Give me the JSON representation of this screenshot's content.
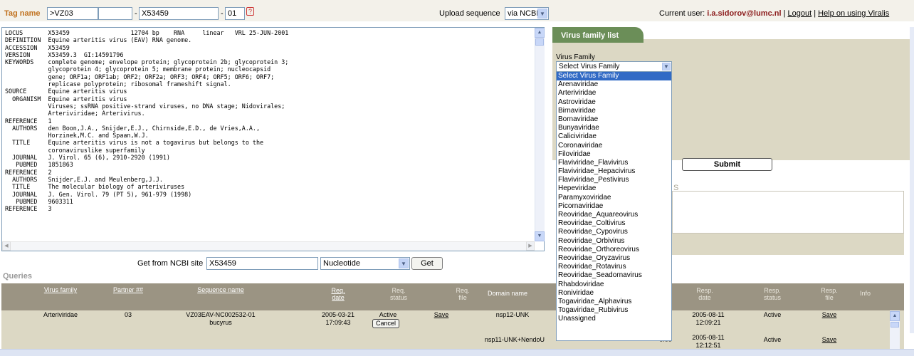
{
  "header": {
    "tag_name_label": "Tag name",
    "tag_field_1": ">VZ03",
    "tag_field_2": "",
    "tag_separator": "-",
    "tag_field_3": "X53459",
    "tag_separator_2": "-",
    "tag_field_4": "01",
    "help_glyph": "?",
    "upload_label": "Upload sequence",
    "upload_option": "via NCBI",
    "current_user_label": "Current user:",
    "current_user": "i.a.sidorov@lumc.nl",
    "separator": "|",
    "logout": "Logout",
    "help_link": "Help on using Viralis"
  },
  "genbank": {
    "text": "LOCUS       X53459                 12704 bp    RNA     linear   VRL 25-JUN-2001\nDEFINITION  Equine arteritis virus (EAV) RNA genome.\nACCESSION   X53459\nVERSION     X53459.3  GI:14591796\nKEYWORDS    complete genome; envelope protein; glycoprotein 2b; glycoprotein 3;\n            glycoprotein 4; glycoprotein 5; membrane protein; nucleocapsid\n            gene; ORF1a; ORF1ab; ORF2; ORF2a; ORF3; ORF4; ORF5; ORF6; ORF7;\n            replicase polyprotein; ribosomal frameshift signal.\nSOURCE      Equine arteritis virus\n  ORGANISM  Equine arteritis virus\n            Viruses; ssRNA positive-strand viruses, no DNA stage; Nidovirales;\n            Arteriviridae; Arterivirus.\nREFERENCE   1\n  AUTHORS   den Boon,J.A., Snijder,E.J., Chirnside,E.D., de Vries,A.A.,\n            Horzinek,M.C. and Spaan,W.J.\n  TITLE     Equine arteritis virus is not a togavirus but belongs to the\n            coronaviruslike superfamily\n  JOURNAL   J. Virol. 65 (6), 2910-2920 (1991)\n   PUBMED   1851863\nREFERENCE   2\n  AUTHORS   Snijder,E.J. and Meulenberg,J.J.\n  TITLE     The molecular biology of arteriviruses\n  JOURNAL   J. Gen. Virol. 79 (PT 5), 961-979 (1998)\n   PUBMED   9603311\nREFERENCE   3"
  },
  "ncbi": {
    "label": "Get from NCBI site",
    "value": "X53459",
    "db_option": "Nucleotide",
    "get_button": "Get"
  },
  "virus_panel": {
    "tab_title": "Virus family list",
    "field_label": "Virus Family",
    "selected": "Select Virus Family",
    "submit": "Submit",
    "partial_letter": "S",
    "options": [
      "Select Virus Family",
      "Arenaviridae",
      "Arteriviridae",
      "Astroviridae",
      "Birnaviridae",
      "Bornaviridae",
      "Bunyaviridae",
      "Caliciviridae",
      "Coronaviridae",
      "Filoviridae",
      "Flaviviridae_Flavivirus",
      "Flaviviridae_Hepacivirus",
      "Flaviviridae_Pestivirus",
      "Hepeviridae",
      "Paramyxoviridae",
      "Picornaviridae",
      "Reoviridae_Aquareovirus",
      "Reoviridae_Coltivirus",
      "Reoviridae_Cypovirus",
      "Reoviridae_Orbivirus",
      "Reoviridae_Orthoreovirus",
      "Reoviridae_Oryzavirus",
      "Reoviridae_Rotavirus",
      "Reoviridae_Seadornavirus",
      "Rhabdoviridae",
      "Roniviridae",
      "Togaviridae_Alphavirus",
      "Togaviridae_Rubivirus",
      "Unassigned"
    ]
  },
  "queries": {
    "title": "Queries",
    "columns": {
      "virus_family": "Virus family",
      "partner": "Partner ##",
      "sequence_name": "Sequence name",
      "req_date_1": "Req.",
      "req_date_2": "date",
      "req_status_1": "Req.",
      "req_status_2": "status",
      "req_file_1": "Req.",
      "req_file_2": "file",
      "domain_name": "Domain name",
      "resp_date_1": "Resp.",
      "resp_date_2": "date",
      "resp_status_1": "Resp.",
      "resp_status_2": "status",
      "resp_file_1": "Resp.",
      "resp_file_2": "file",
      "info": "Info"
    },
    "rows": [
      {
        "virus_family": "Arteriviridae",
        "partner": "03",
        "sequence_name_1": "VZ03EAV-NC002532-01",
        "sequence_name_2": "bucyrus",
        "req_date_1": "2005-03-21",
        "req_date_2": "17:09:43",
        "req_status": "Active",
        "cancel": "Cancel",
        "req_file": "Save",
        "domain_name": "nsp12-UNK",
        "resp_date_1": "2005-08-11",
        "resp_date_2": "12:09:21",
        "resp_status": "Active",
        "resp_file": "Save"
      },
      {
        "domain_name": "nsp11-UNK+NendoU",
        "partial": "0:00",
        "resp_date_1": "2005-08-11",
        "resp_date_2": "12:12:51",
        "resp_status": "Active",
        "resp_file": "Save"
      }
    ]
  }
}
